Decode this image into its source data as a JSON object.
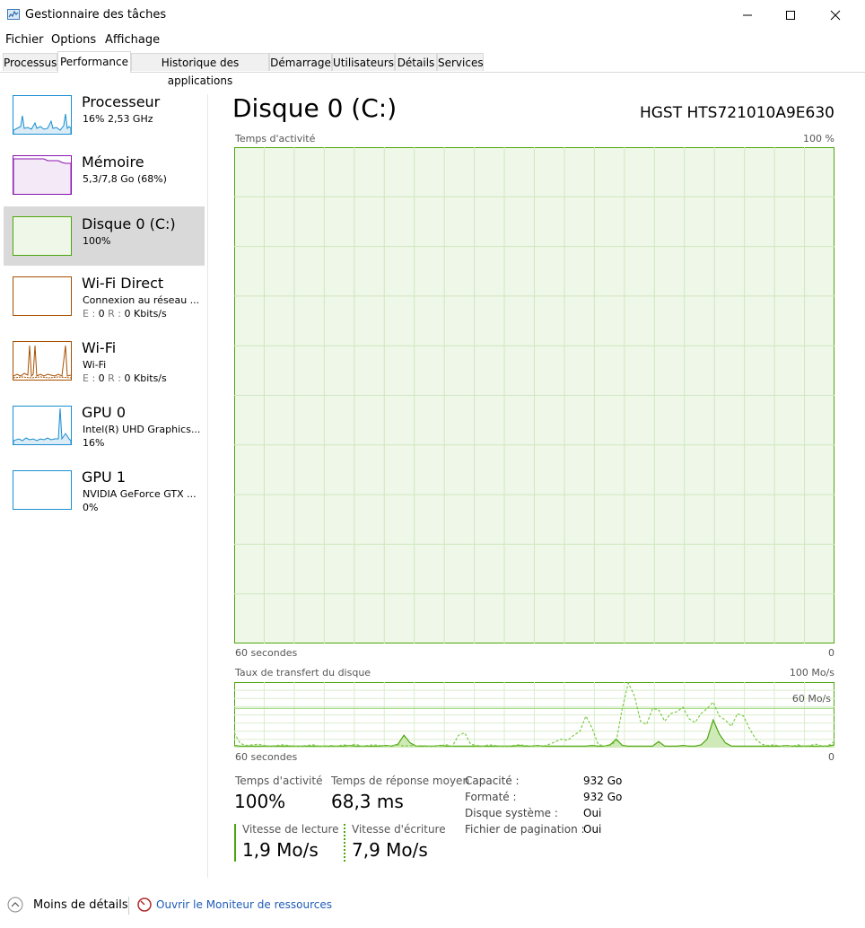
{
  "window": {
    "title": "Gestionnaire des tâches"
  },
  "menu": [
    "Fichier",
    "Options",
    "Affichage"
  ],
  "tabs": [
    "Processus",
    "Performance",
    "Historique des applications",
    "Démarrage",
    "Utilisateurs",
    "Détails",
    "Services"
  ],
  "sidebar": {
    "items": [
      {
        "name": "Processeur",
        "line1": "16%  2,53 GHz",
        "line2": ""
      },
      {
        "name": "Mémoire",
        "line1": "5,3/7,8 Go (68%)",
        "line2": ""
      },
      {
        "name": "Disque 0 (C:)",
        "line1": "100%",
        "line2": ""
      },
      {
        "name": "Wi-Fi Direct",
        "line1": "Connexion au réseau ...",
        "line2_e": "E :",
        "line2_ev": "0",
        "line2_r": "R :",
        "line2_rv": "0 Kbits/s"
      },
      {
        "name": "Wi-Fi",
        "line1": "Wi-Fi",
        "line2_e": "E :",
        "line2_ev": "0",
        "line2_r": "R :",
        "line2_rv": "0 Kbits/s"
      },
      {
        "name": "GPU 0",
        "line1": "Intel(R) UHD Graphics...",
        "line2": "16%"
      },
      {
        "name": "GPU 1",
        "line1": "NVIDIA GeForce GTX ...",
        "line2": "0%"
      }
    ]
  },
  "main": {
    "title": "Disque 0 (C:)",
    "model": "HGST HTS721010A9E630",
    "activity_label": "Temps d'activité",
    "activity_max": "100 %",
    "axis_left": "60 secondes",
    "axis_right": "0",
    "transfer_label": "Taux de transfert du disque",
    "transfer_max": "100 Mo/s",
    "transfer_mid": "60 Mo/s",
    "stats": {
      "activity_label": "Temps d'activité",
      "activity_value": "100%",
      "response_label": "Temps de réponse moyen",
      "response_value": "68,3 ms",
      "read_label": "Vitesse de lecture",
      "read_value": "1,9 Mo/s",
      "write_label": "Vitesse d'écriture",
      "write_value": "7,9 Mo/s"
    },
    "props": [
      {
        "label": "Capacité :",
        "value": "932 Go"
      },
      {
        "label": "Formaté :",
        "value": "932 Go"
      },
      {
        "label": "Disque système :",
        "value": "Oui"
      },
      {
        "label": "Fichier de pagination :",
        "value": "Oui"
      }
    ]
  },
  "footer": {
    "less_details": "Moins de détails",
    "resource_monitor": "Ouvrir le Moniteur de ressources"
  },
  "colors": {
    "disk_green": "#4da60c",
    "disk_fill": "#eff7e9",
    "cpu_blue": "#1a8fd1",
    "mem_purple": "#8b12ae",
    "wifi_orange": "#a74f01"
  },
  "chart_data": {
    "type": "line",
    "title": "Taux de transfert du disque",
    "ylim": [
      0,
      100
    ],
    "ylabel": "",
    "series": [
      {
        "name": "Vitesse de lecture",
        "values": [
          2,
          1,
          1,
          1,
          1,
          1,
          1,
          1,
          1,
          1,
          1,
          1,
          1,
          1,
          1,
          1,
          1,
          1,
          1,
          2,
          1,
          1,
          1,
          1,
          1,
          2,
          1,
          4,
          18,
          6,
          1,
          1,
          1,
          1,
          2,
          1,
          1,
          1,
          1,
          1,
          1,
          1,
          1,
          1,
          1,
          1,
          1,
          2,
          1,
          1,
          2,
          1,
          1,
          1,
          1,
          1,
          1,
          1,
          1,
          2,
          1,
          1,
          3,
          12,
          2,
          1,
          1,
          1,
          1,
          1,
          8,
          1,
          1,
          1,
          2,
          1,
          1,
          3,
          12,
          42,
          20,
          6,
          1,
          1,
          1,
          1,
          1,
          1,
          1,
          1,
          1,
          2,
          1,
          1,
          1,
          1,
          1,
          1,
          1,
          3
        ]
      },
      {
        "name": "Vitesse d'écriture",
        "values": [
          22,
          5,
          2,
          3,
          4,
          2,
          1,
          2,
          3,
          2,
          1,
          1,
          2,
          3,
          1,
          1,
          2,
          1,
          3,
          2,
          4,
          1,
          2,
          3,
          2,
          1,
          2,
          3,
          1,
          2,
          1,
          2,
          1,
          1,
          2,
          3,
          1,
          18,
          22,
          4,
          2,
          1,
          3,
          2,
          1,
          1,
          2,
          3,
          2,
          1,
          2,
          1,
          4,
          8,
          12,
          10,
          18,
          24,
          48,
          30,
          4,
          1,
          2,
          8,
          60,
          100,
          80,
          40,
          35,
          60,
          58,
          40,
          52,
          55,
          62,
          44,
          38,
          52,
          60,
          70,
          48,
          42,
          32,
          52,
          48,
          28,
          12,
          4,
          2,
          3,
          1,
          2,
          1,
          3,
          1,
          2,
          4,
          1,
          2,
          8
        ]
      }
    ]
  }
}
